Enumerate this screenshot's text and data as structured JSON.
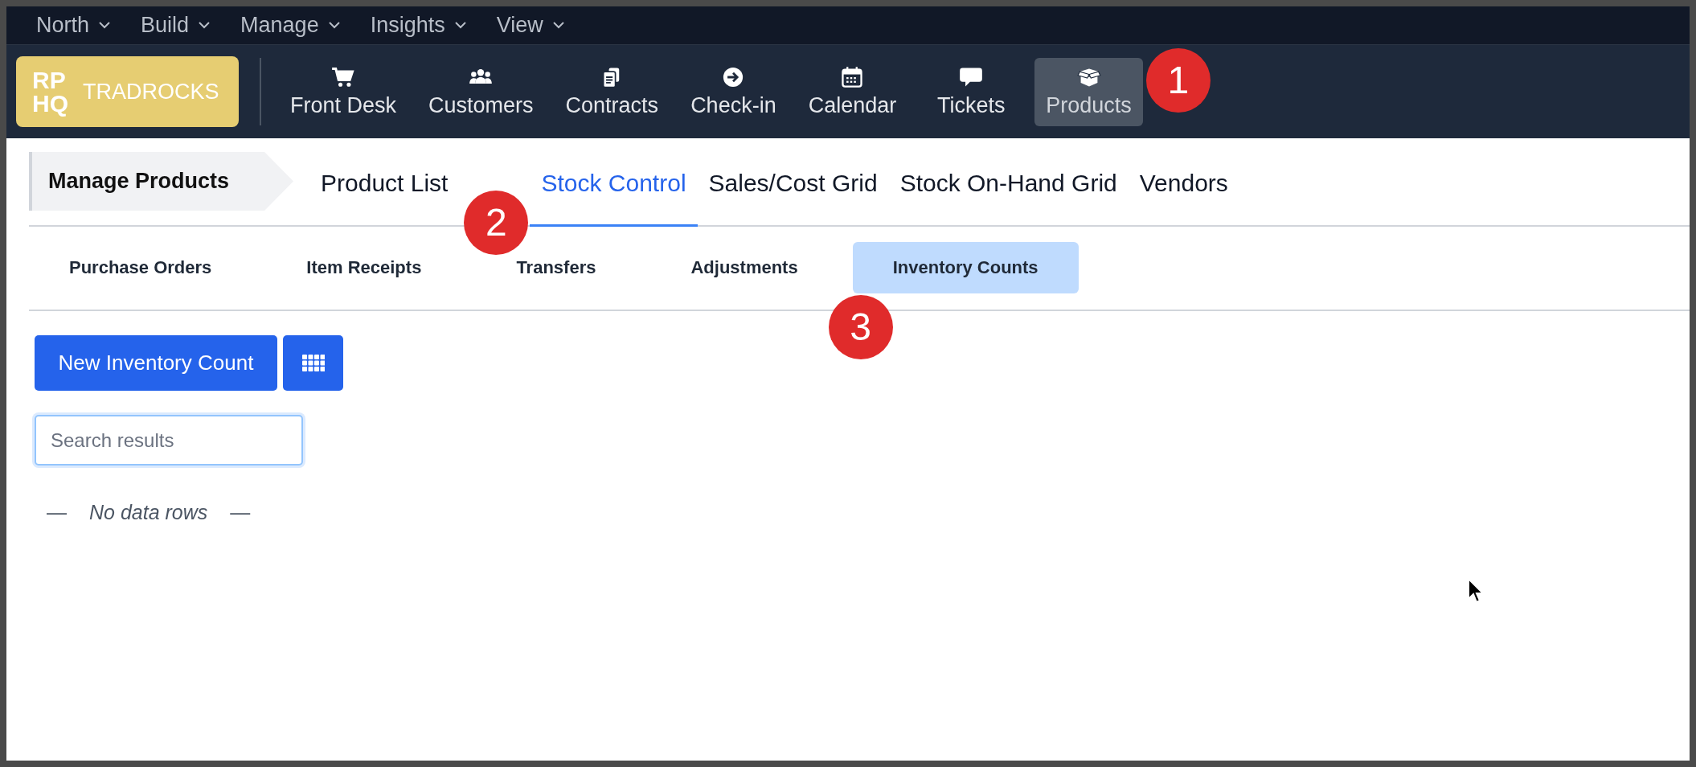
{
  "menu": [
    {
      "label": "North"
    },
    {
      "label": "Build"
    },
    {
      "label": "Manage"
    },
    {
      "label": "Insights"
    },
    {
      "label": "View"
    }
  ],
  "brand": {
    "mark_lines": [
      "RP",
      "HQ"
    ],
    "name": "TRADROCKS"
  },
  "nav": [
    {
      "label": "Front Desk",
      "kind": "cart",
      "selected": false
    },
    {
      "label": "Customers",
      "kind": "users",
      "selected": false
    },
    {
      "label": "Contracts",
      "kind": "files",
      "selected": false
    },
    {
      "label": "Check-in",
      "kind": "arrow",
      "selected": false
    },
    {
      "label": "Calendar",
      "kind": "calendar",
      "selected": false
    },
    {
      "label": "Tickets",
      "kind": "chat",
      "selected": false
    },
    {
      "label": "Products",
      "kind": "box",
      "selected": true,
      "callout": "1"
    }
  ],
  "page_title": "Manage Products",
  "tabs": [
    {
      "label": "Product List",
      "selected": false
    },
    {
      "label": "Stock Control",
      "selected": true,
      "callout": "2"
    },
    {
      "label": "Sales/Cost Grid",
      "selected": false
    },
    {
      "label": "Stock On-Hand Grid",
      "selected": false
    },
    {
      "label": "Vendors",
      "selected": false
    }
  ],
  "subtabs": [
    {
      "label": "Purchase Orders",
      "selected": false
    },
    {
      "label": "Item Receipts",
      "selected": false
    },
    {
      "label": "Transfers",
      "selected": false
    },
    {
      "label": "Adjustments",
      "selected": false
    },
    {
      "label": "Inventory Counts",
      "selected": true,
      "callout": "3"
    }
  ],
  "new_button": "New Inventory Count",
  "search": {
    "placeholder": "Search results"
  },
  "empty_message": {
    "lead": "—",
    "text": "No data rows",
    "trail": "—"
  }
}
